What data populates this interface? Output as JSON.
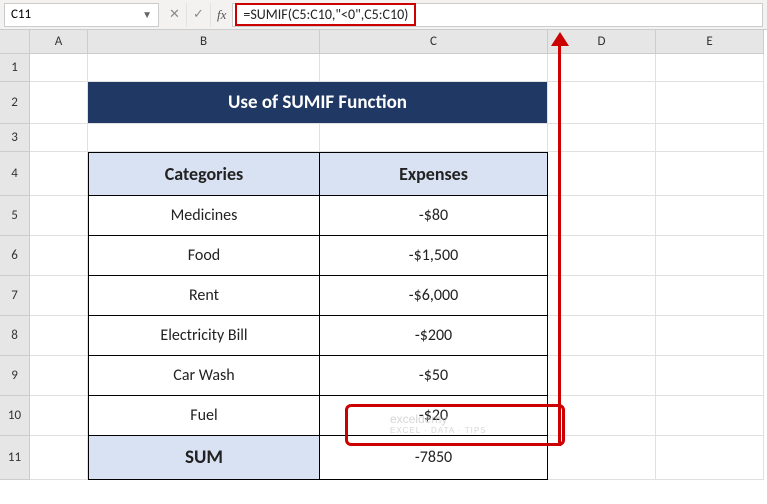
{
  "name_box": "C11",
  "formula": "=SUMIF(C5:C10,\"<0\",C5:C10)",
  "columns": [
    "A",
    "B",
    "C",
    "D",
    "E"
  ],
  "rows": [
    "1",
    "2",
    "3",
    "4",
    "5",
    "6",
    "7",
    "8",
    "9",
    "10",
    "11"
  ],
  "title": "Use of SUMIF Function",
  "headers": {
    "categories": "Categories",
    "expenses": "Expenses"
  },
  "data": [
    {
      "cat": "Medicines",
      "exp": "-$80"
    },
    {
      "cat": "Food",
      "exp": "-$1,500"
    },
    {
      "cat": "Rent",
      "exp": "-$6,000"
    },
    {
      "cat": "Electricity Bill",
      "exp": "-$200"
    },
    {
      "cat": "Car Wash",
      "exp": "-$50"
    },
    {
      "cat": "Fuel",
      "exp": "-$20"
    }
  ],
  "sum_label": "SUM",
  "sum_value": "-7850",
  "fx_label": "fx",
  "watermark": {
    "name": "exceldemy",
    "tag": "EXCEL · DATA · TIPS"
  },
  "icons": {
    "dropdown": "▼",
    "cancel": "✕",
    "confirm": "✓"
  }
}
